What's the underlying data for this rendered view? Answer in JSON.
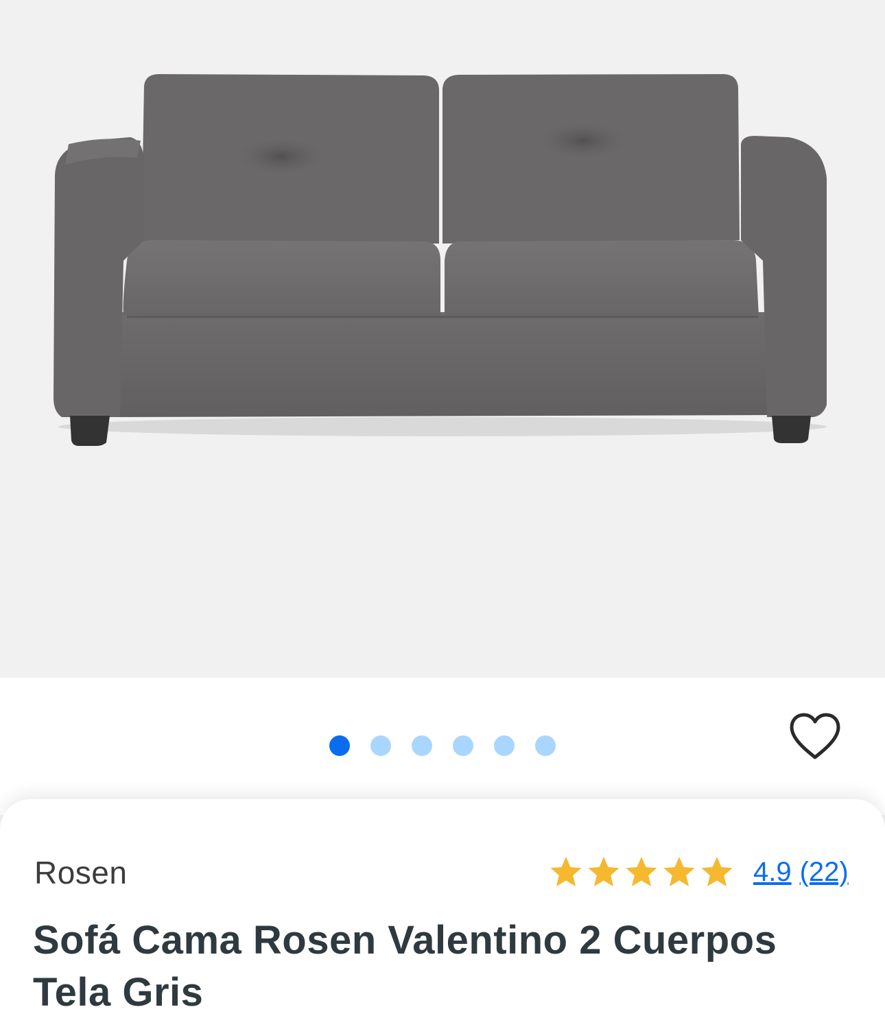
{
  "product": {
    "image_alt": "Sofá Cama Rosen Valentino 2 Cuerpos Tela Gris",
    "brand": "Rosen",
    "title": "Sofá Cama Rosen Valentino 2 Cuerpos Tela Gris",
    "rating": {
      "value": "4.9",
      "count": "(22)",
      "stars": 5
    },
    "gallery": {
      "total_images": 6,
      "active_index": 0
    }
  },
  "icons": {
    "favorite": "heart-outline-icon",
    "star": "star-icon"
  },
  "colors": {
    "accent": "#0a6df0",
    "dot_inactive": "#a9d6ff",
    "star": "#f5b82e",
    "title": "#2f3a40",
    "sofa": "#6b6969"
  }
}
